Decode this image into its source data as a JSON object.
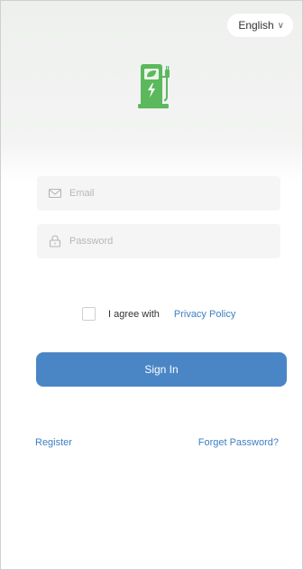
{
  "language": {
    "label": "English"
  },
  "login": {
    "email_placeholder": "Email",
    "password_placeholder": "Password",
    "agree_text": "I agree with",
    "privacy_link": "Privacy Policy",
    "signin_label": "Sign In",
    "register_link": "Register",
    "forget_link": "Forget Password?"
  },
  "icons": {
    "logo": "ev-charging-station-icon",
    "email": "envelope-icon",
    "password": "lock-icon",
    "language": "chevron-down-icon"
  },
  "colors": {
    "brand_green": "#5cb85c",
    "primary_blue": "#4a86c6",
    "link_blue": "#3d7fc4"
  }
}
